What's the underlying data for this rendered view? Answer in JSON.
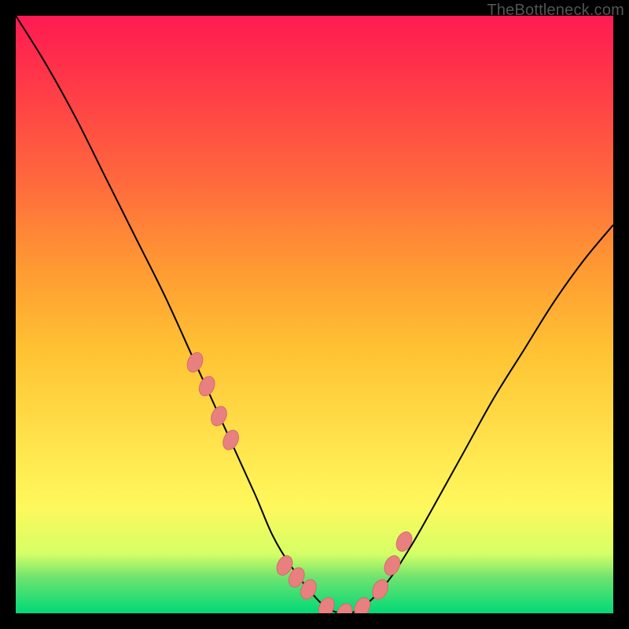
{
  "watermark": "TheBottleneck.com",
  "colors": {
    "frame": "#000000",
    "curve": "#000000",
    "dot_fill": "#e98080",
    "dot_stroke": "#d46a6a"
  },
  "chart_data": {
    "type": "line",
    "title": "",
    "xlabel": "",
    "ylabel": "",
    "xlim": [
      0,
      100
    ],
    "ylim": [
      0,
      100
    ],
    "series": [
      {
        "name": "bottleneck-curve",
        "x": [
          0,
          5,
          10,
          15,
          20,
          25,
          30,
          35,
          40,
          43,
          46,
          49,
          52,
          55,
          58,
          62,
          66,
          70,
          75,
          80,
          85,
          90,
          95,
          100
        ],
        "y": [
          100,
          92,
          83,
          73,
          63,
          53,
          42,
          31,
          20,
          13,
          8,
          4,
          1,
          0,
          1,
          5,
          11,
          18,
          27,
          36,
          44,
          52,
          59,
          65
        ]
      }
    ],
    "highlight_points": {
      "name": "curve-dots",
      "x": [
        30,
        32,
        34,
        36,
        45,
        47,
        49,
        52,
        55,
        58,
        61,
        63,
        65
      ],
      "y": [
        42,
        38,
        33,
        29,
        8,
        6,
        4,
        1,
        0,
        1,
        4,
        8,
        12
      ]
    }
  }
}
